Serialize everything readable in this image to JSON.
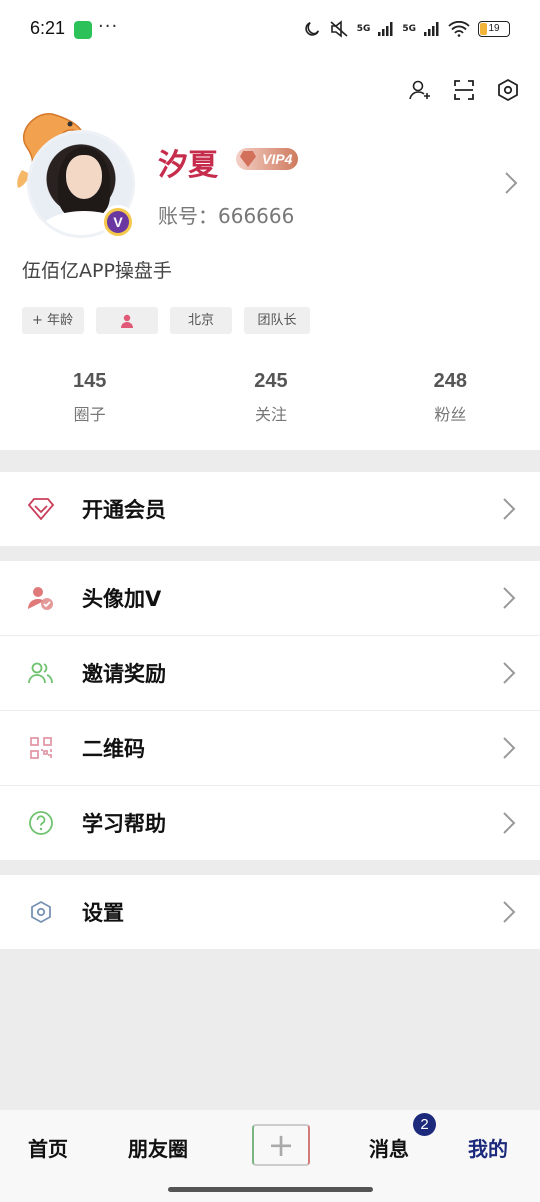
{
  "status_bar": {
    "time": "6:21",
    "dots": "···",
    "battery": "19",
    "net1": "5G",
    "net2": "5G"
  },
  "profile": {
    "name": "汐夏",
    "vip_label": "VIP4",
    "account": "账号：666666",
    "badge_letter": "V",
    "bio": "伍佰亿APP操盘手",
    "tags": {
      "age": "+ 年龄",
      "city": "北京",
      "role": "团队长"
    },
    "stats": [
      {
        "value": "145",
        "label": "圈子"
      },
      {
        "value": "245",
        "label": "关注"
      },
      {
        "value": "248",
        "label": "粉丝"
      }
    ]
  },
  "menu": {
    "membership": "开通会员",
    "avatar_v": "头像加V",
    "invite": "邀请奖励",
    "qrcode": "二维码",
    "help": "学习帮助",
    "settings": "设置"
  },
  "bottom_nav": {
    "home": "首页",
    "friends": "朋友圈",
    "plus": "+",
    "messages": "消息",
    "messages_badge": "2",
    "mine": "我的"
  },
  "colors": {
    "accent_red": "#c62c4b",
    "nav_active": "#1d2a7c",
    "status_green": "#2dc15a"
  }
}
